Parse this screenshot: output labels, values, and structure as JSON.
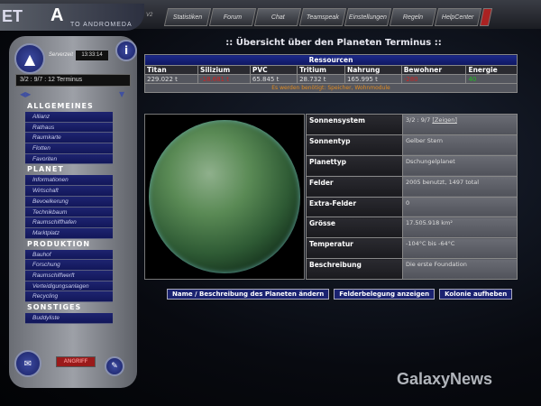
{
  "logo": {
    "left": "ET",
    "mark": "A",
    "subtitle": "TO ANDROMEDA",
    "version": "V2"
  },
  "nav": [
    "Statistiken",
    "Forum",
    "Chat",
    "Teamspeak",
    "Einstellungen",
    "Regeln",
    "HelpCenter"
  ],
  "side": {
    "server_label": "Serverzeit",
    "time": "13:33:14",
    "coordinates": "3/2 : 9/7 : 12 Terminus",
    "attack_label": "ANGRIFF",
    "sections": [
      {
        "title": "ALLGEMEINES",
        "items": [
          "Allianz",
          "Rathaus",
          "Raumkarte",
          "Flotten",
          "Favoriten"
        ]
      },
      {
        "title": "PLANET",
        "items": [
          "Informationen",
          "Wirtschaft",
          "Bevoelkerung",
          "Technikbaum",
          "Raumschiffhafen",
          "Marktplatz"
        ]
      },
      {
        "title": "PRODUKTION",
        "items": [
          "Bauhof",
          "Forschung",
          "Raumschiffwerft",
          "Verteidigungsanlagen",
          "Recycling"
        ]
      },
      {
        "title": "SONSTIGES",
        "items": [
          "Buddyliste"
        ]
      }
    ]
  },
  "page_title": ":: Übersicht über den Planeten Terminus ::",
  "resources": {
    "title": "Ressourcen",
    "headers": [
      "Titan",
      "Silizium",
      "PVC",
      "Tritium",
      "Nahrung",
      "Bewohner",
      "Energie"
    ],
    "values": [
      "229.022 t",
      "-18.681 t",
      "65.845 t",
      "28.732 t",
      "165.995 t",
      "-280",
      "40"
    ],
    "note": "Es werden benötigt: Speicher, Wohnmodule",
    "colors": {
      "negative": "#cc2222",
      "positive": "#22bb22",
      "note": "#e08a20"
    }
  },
  "planet_info": [
    {
      "label": "Sonnensystem",
      "value": "3/2 : 9/7",
      "link": "[Zeigen]"
    },
    {
      "label": "Sonnentyp",
      "value": "Gelber Stern"
    },
    {
      "label": "Planettyp",
      "value": "Dschungelplanet"
    },
    {
      "label": "Felder",
      "value": "2005 benutzt, 1497 total"
    },
    {
      "label": "Extra-Felder",
      "value": "0"
    },
    {
      "label": "Grösse",
      "value": "17.505.918 km²"
    },
    {
      "label": "Temperatur",
      "value": "-104°C bis -64°C"
    },
    {
      "label": "Beschreibung",
      "value": "Die erste Foundation"
    }
  ],
  "buttons": [
    "Name / Beschreibung des Planeten ändern",
    "Felderbelegung anzeigen",
    "Kolonie aufheben"
  ],
  "watermark": "GalaxyNews"
}
